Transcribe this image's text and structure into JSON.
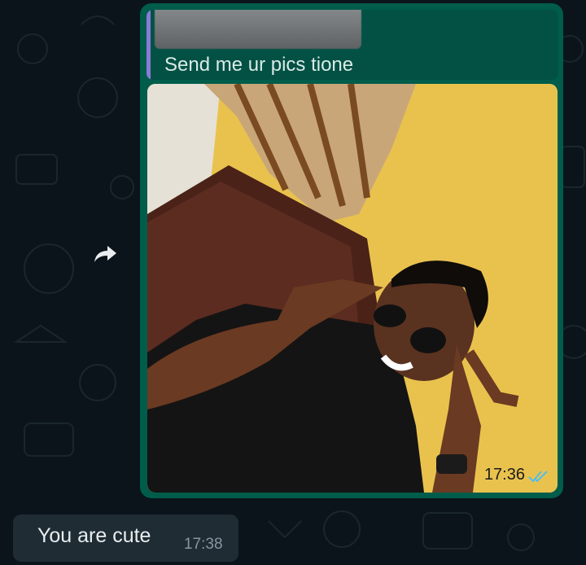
{
  "messages": {
    "outgoing": {
      "quote_text": "Send me ur pics tione",
      "time": "17:36",
      "status": "read",
      "image_alt": "Photo of a man in sunglasses making hand gestures"
    },
    "incoming": {
      "text": "You are cute",
      "time": "17:38"
    }
  },
  "icons": {
    "forward": "share-arrow-icon",
    "read_receipt": "double-check-icon"
  },
  "colors": {
    "background": "#0b141a",
    "outgoing_bubble": "#005c4b",
    "incoming_bubble": "#1f2c34",
    "read_tick": "#53bdeb",
    "quote_bar": "#8a7bd6"
  }
}
